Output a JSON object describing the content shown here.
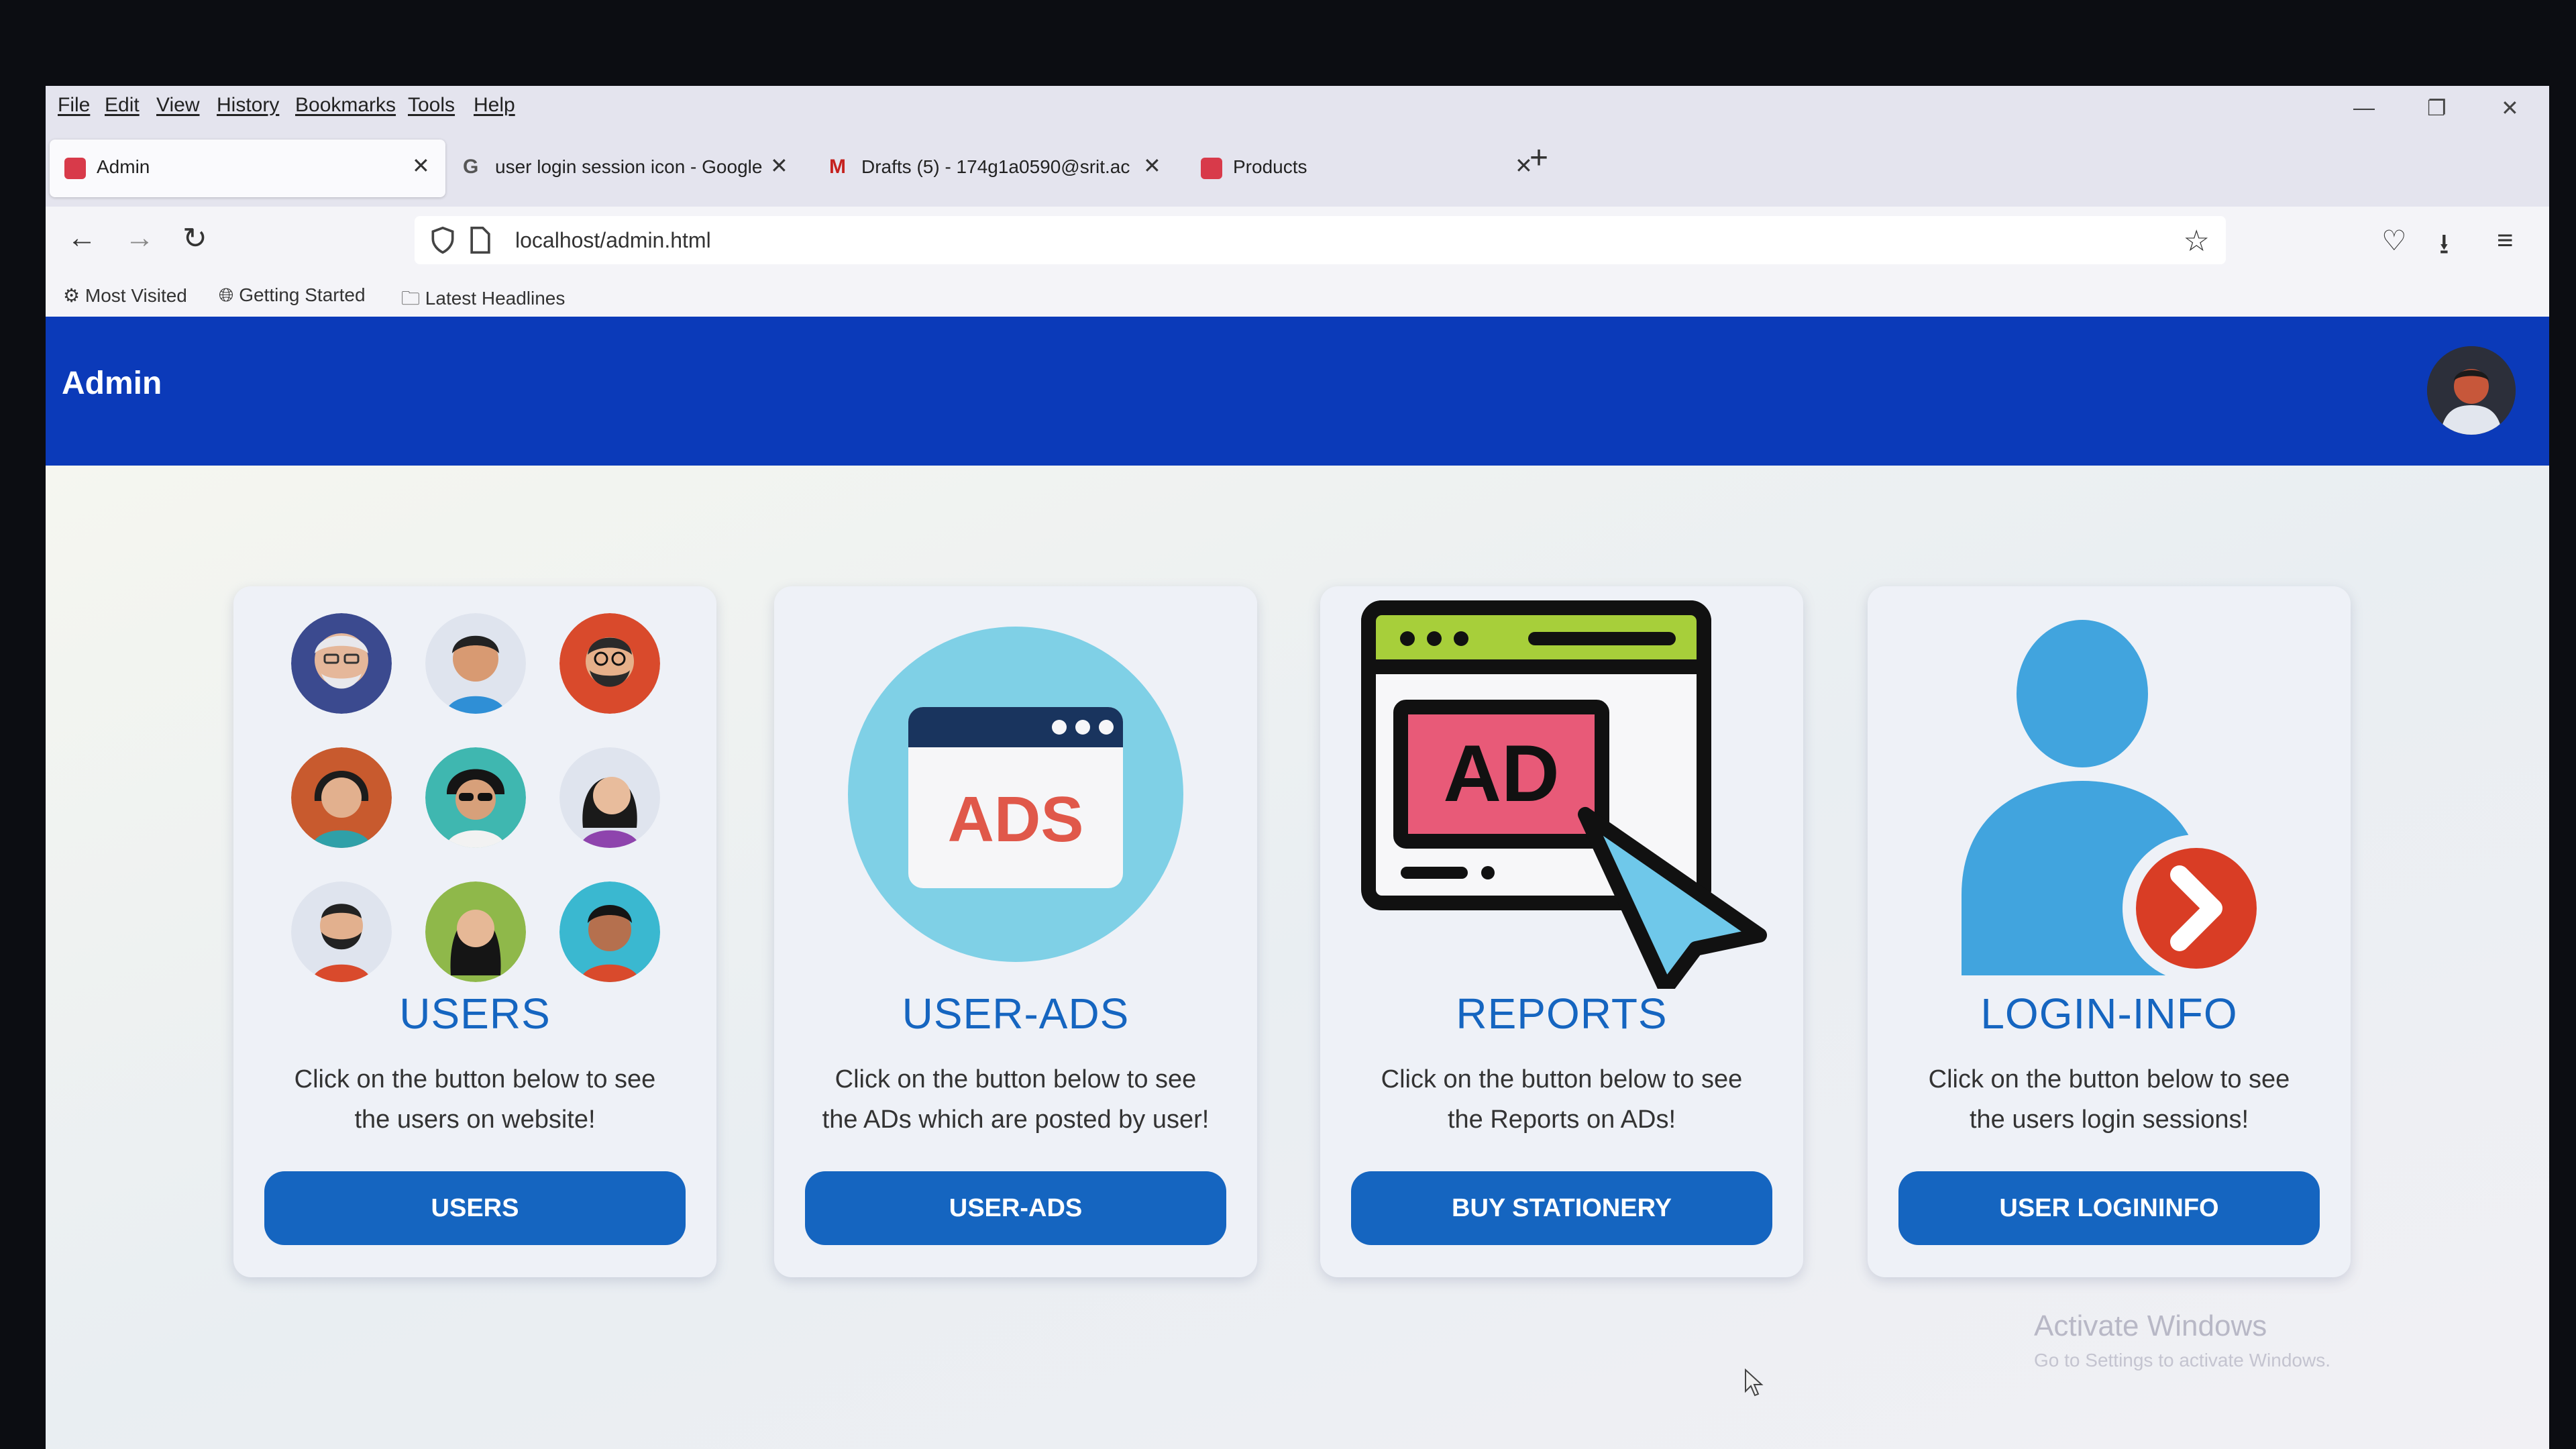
{
  "browser": {
    "menu": [
      "File",
      "Edit",
      "View",
      "History",
      "Bookmarks",
      "Tools",
      "Help"
    ],
    "tabs": [
      {
        "title": "Admin"
      },
      {
        "title": "user login session icon - Google"
      },
      {
        "title": "Drafts (5) - 174g1a0590@srit.ac"
      },
      {
        "title": "Products"
      }
    ],
    "url": "localhost/admin.html",
    "bookmarks": [
      "Most Visited",
      "Getting Started",
      "Latest Headlines"
    ]
  },
  "app": {
    "title": "Admin"
  },
  "cards": [
    {
      "title": "USERS",
      "desc_line1": "Click on the button below to see",
      "desc_line2": "the users on website!",
      "button": "USERS"
    },
    {
      "title": "USER-ADS",
      "desc_line1": "Click on the button below to see",
      "desc_line2": "the ADs which are posted by user!",
      "button": "USER-ADS",
      "icon_text": "ADS"
    },
    {
      "title": "REPORTS",
      "desc_line1": "Click on the button below to see",
      "desc_line2": "the Reports on ADs!",
      "button": "BUY STATIONERY",
      "icon_text": "AD"
    },
    {
      "title": "LOGIN-INFO",
      "desc_line1": "Click on the button below to see",
      "desc_line2": "the users login sessions!",
      "button": "USER LOGININFO"
    }
  ],
  "watermark": {
    "line1": "Activate Windows",
    "line2": "Go to Settings to activate Windows."
  },
  "colors": {
    "header": "#0b3ab9",
    "accent": "#1565c0"
  }
}
